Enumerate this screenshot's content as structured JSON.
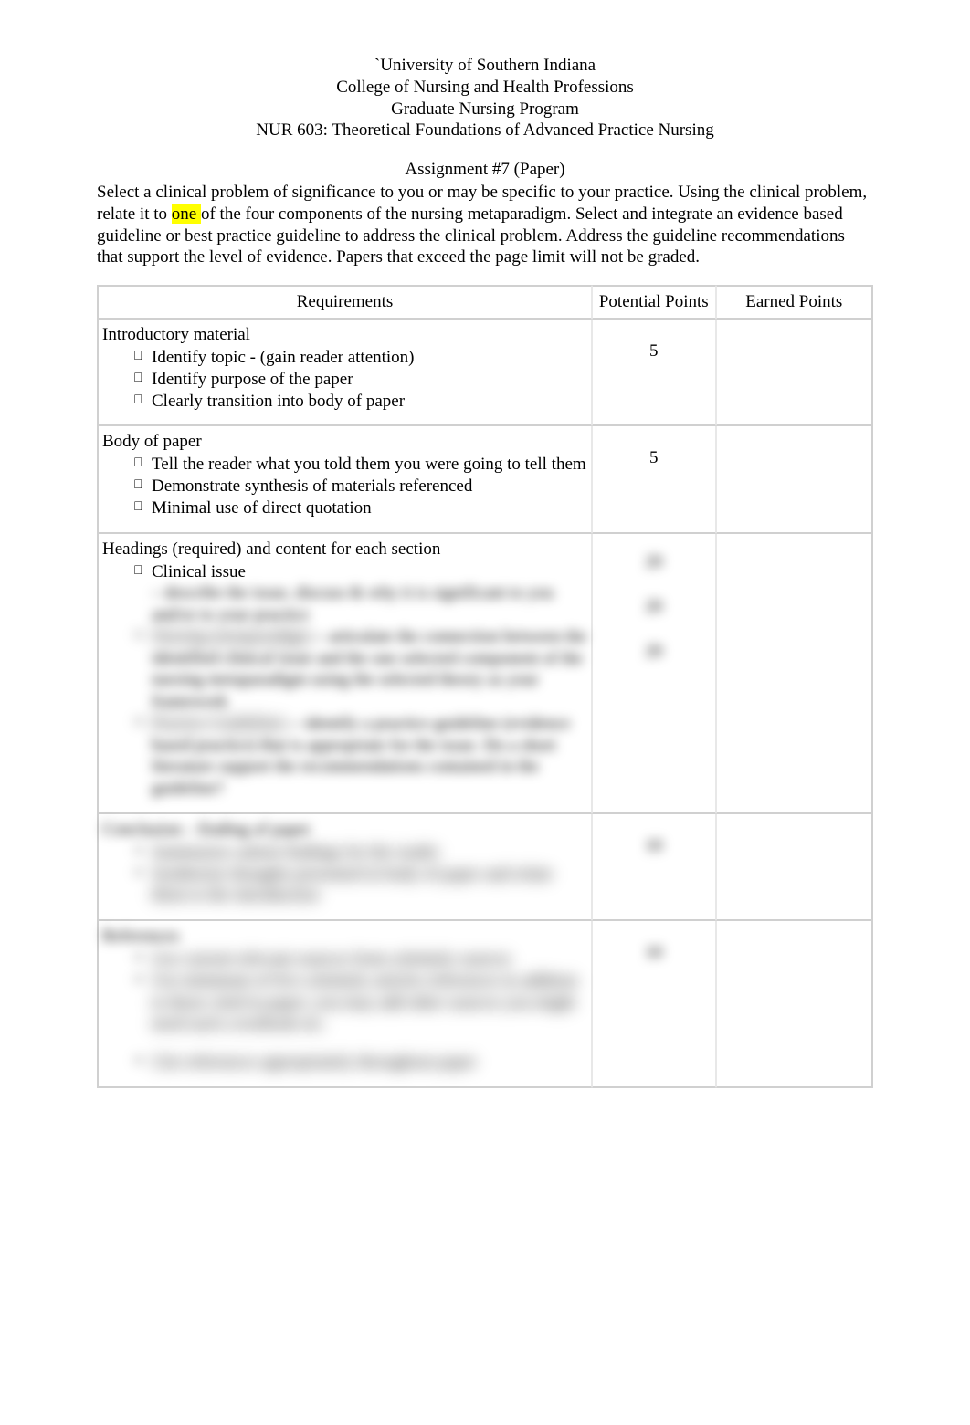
{
  "header": {
    "line1": "`University of Southern Indiana",
    "line2": "College of Nursing and Health Professions",
    "line3": "Graduate Nursing Program",
    "line4": "NUR 603: Theoretical Foundations of Advanced Practice Nursing"
  },
  "assignment_title": "Assignment #7 (Paper)",
  "intro": {
    "part1": "Select a clinical problem of significance to you or may be specific to your practice. Using the clinical problem, relate it to ",
    "highlighted": "one ",
    "part2": "of the four components of the nursing metaparadigm. Select and integrate an evidence based guideline or best practice guideline to address the clinical problem. Address the guideline recommendations that support the level of evidence. Papers that exceed the page limit will not be graded."
  },
  "table": {
    "headers": {
      "requirements": "Requirements",
      "potential_points": "Potential Points",
      "earned_points": "Earned Points"
    },
    "rows": [
      {
        "title": "Introductory material",
        "items": [
          {
            "label": "Identify topic  - (gain reader attention)"
          },
          {
            "label": "Identify purpose of the paper"
          },
          {
            "label": "Clearly transition into body of paper"
          }
        ],
        "points": [
          "5"
        ],
        "earned": ""
      },
      {
        "title": "Body of paper",
        "items": [
          {
            "label": "Tell the reader what you told them you were going to tell them"
          },
          {
            "label": "Demonstrate synthesis of materials referenced"
          },
          {
            "label": "Minimal use of direct quotation"
          }
        ],
        "points": [
          "5"
        ],
        "earned": ""
      },
      {
        "title": "Headings (required) and content for each section",
        "items": [
          {
            "label": "Clinical issue",
            "desc": " – describe the issue, discuss & why it is significant to you and/or to your practice",
            "keep_label": true
          },
          {
            "label": "Nursing metaparadigm",
            "desc": " – articulate the connection between the identified clinical issue and the one selected component of the nursing metaparadigm using the selected theory as your framework"
          },
          {
            "label": "Practice Guidelines",
            "desc": " – identify a practice guideline (evidence based practice) that is appropriate for the issue. Do a short literature support the recommendations contained in the guideline?"
          }
        ],
        "points": [
          "20",
          "20",
          "20"
        ],
        "earned": "",
        "blurred": true,
        "keep_title": true
      },
      {
        "title": "Conclusion – Ending of paper",
        "items": [
          {
            "label": "Summarize salient findings for the reader"
          },
          {
            "label": "Synthesize thoughts presented in body of paper and relate them to the introduction"
          }
        ],
        "points": [
          "10"
        ],
        "earned": "",
        "blurred": true
      },
      {
        "title": "References",
        "items": [
          {
            "label": "Use current relevant sources from scholarly sources"
          },
          {
            "label": "Use minimum of five scholarly articles references in addition to those cited in paper; you may add other sources you might need such a textbook etc."
          },
          {
            "label": "Cite references appropriately throughout paper",
            "spaced": true
          }
        ],
        "points": [
          "10"
        ],
        "earned": "",
        "blurred": true
      }
    ]
  }
}
